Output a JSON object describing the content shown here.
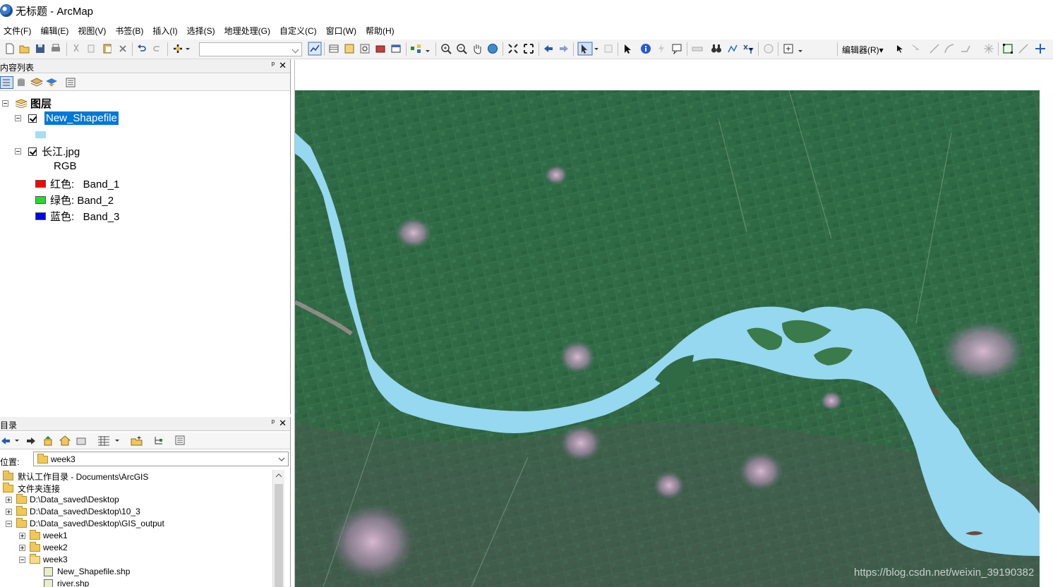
{
  "window": {
    "title": "无标题 - ArcMap"
  },
  "menu": [
    "文件(F)",
    "编辑(E)",
    "视图(V)",
    "书签(B)",
    "插入(I)",
    "选择(S)",
    "地理处理(G)",
    "自定义(C)",
    "窗口(W)",
    "帮助(H)"
  ],
  "toolbar": {
    "editor_label": "编辑器(R)▾"
  },
  "toc": {
    "title": "内容列表",
    "pin": "ᵖ",
    "close": "✕",
    "root_label": "图层",
    "layers": {
      "shapefile": {
        "name": "New_Shapefile",
        "symbol_color": "#a8dcf2"
      },
      "raster": {
        "name": "长江.jpg",
        "band_type": "RGB",
        "red": {
          "label": "红色:   Band_1",
          "color": "#ff0000"
        },
        "green": {
          "label": "绿色: Band_2",
          "color": "#22dd22"
        },
        "blue": {
          "label": "蓝色:   Band_3",
          "color": "#0000ff"
        }
      }
    }
  },
  "catalog": {
    "title": "目录",
    "pin": "ᵖ",
    "close": "✕",
    "location_label": "位置:",
    "location_value": "week3",
    "items": [
      "默认工作目录 - Documents\\ArcGIS",
      "文件夹连接",
      "D:\\Data_saved\\Desktop",
      "D:\\Data_saved\\Desktop\\10_3",
      "D:\\Data_saved\\Desktop\\GIS_output",
      "week1",
      "week2",
      "week3",
      "New_Shapefile.shp",
      "river.shp"
    ]
  },
  "map": {
    "watermark": "https://blog.csdn.net/weixin_39190382",
    "river_color": "#96d8f0"
  }
}
